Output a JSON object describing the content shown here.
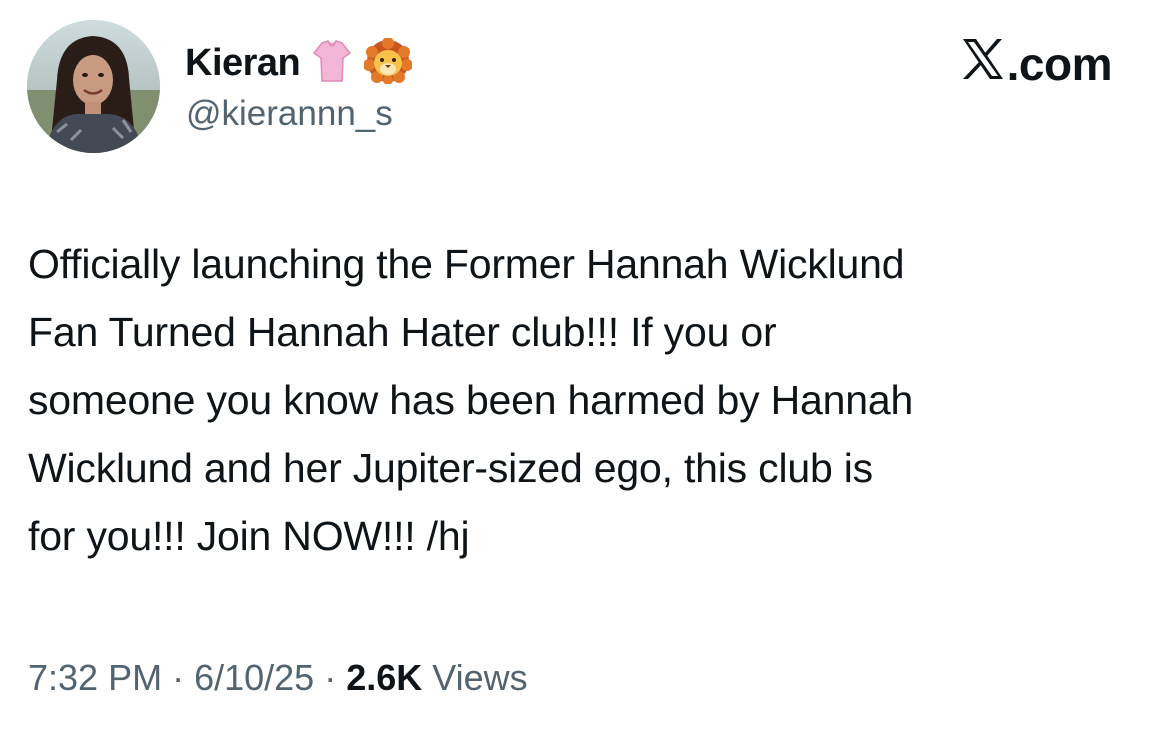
{
  "author": {
    "display_name": "Kieran",
    "badges": [
      "pink-shirt-icon",
      "lion-face-icon"
    ],
    "handle": "@kierannn_s"
  },
  "brand": {
    "label": ".com",
    "icon": "x-logo-icon"
  },
  "tweet": {
    "text": "Officially launching the Former Hannah Wicklund\nFan Turned Hannah Hater club!!! If you or\nsomeone you know has been harmed by Hannah\nWicklund and her Jupiter-sized ego, this club is\nfor you!!! Join NOW!!! /hj"
  },
  "meta": {
    "time": "7:32 PM",
    "separator": " · ",
    "date": "6/10/25",
    "views_count": "2.6K",
    "views_label": " Views"
  },
  "colors": {
    "text_primary": "#0f1419",
    "text_secondary": "#536471",
    "background": "#ffffff"
  }
}
